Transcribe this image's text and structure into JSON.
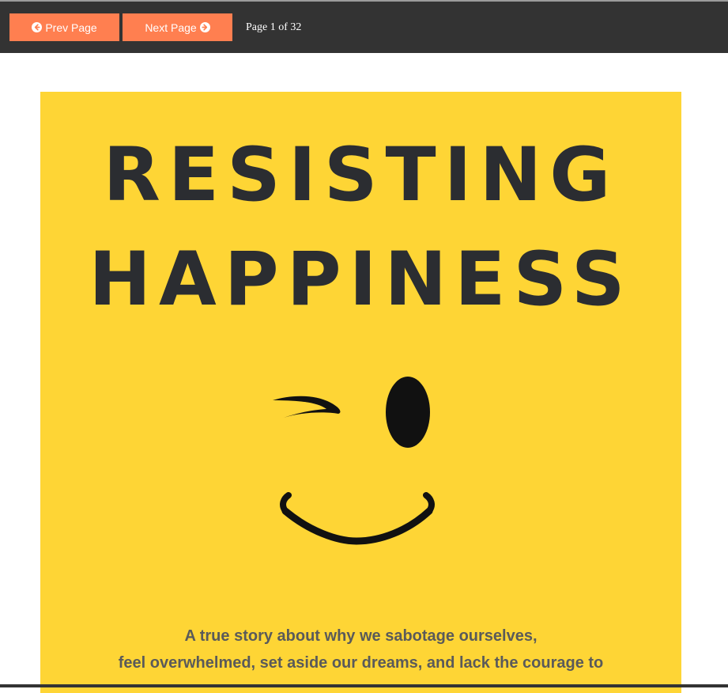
{
  "toolbar": {
    "prev_label": "Prev Page",
    "next_label": "Next Page",
    "page_info": "Page 1 of 32",
    "accent_color": "#ff7f50",
    "bar_color": "#333333"
  },
  "cover": {
    "title_line1": "RESISTING",
    "title_line2": "HAPPINESS",
    "subtitle_line1": "A true story about why we sabotage ourselves,",
    "subtitle_line2": "feel overwhelmed, set aside our dreams, and lack the courage to",
    "background_color": "#fed535",
    "illustration": "winking-smiley-face"
  },
  "icons": {
    "prev": "arrow-circle-left-icon",
    "next": "arrow-circle-right-icon"
  }
}
